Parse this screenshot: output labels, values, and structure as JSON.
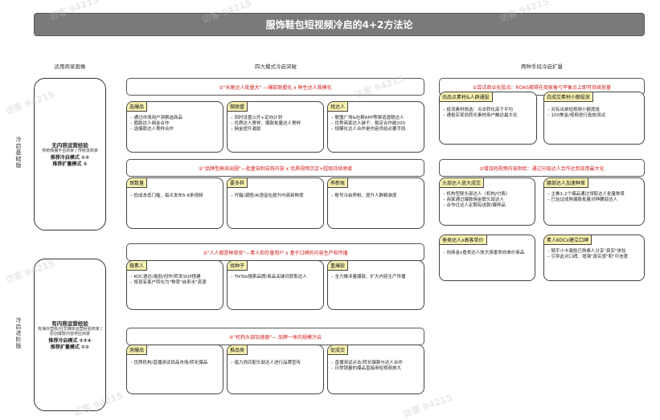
{
  "title": "服饰鞋包短视频冷启的4+2方法论",
  "col_heads": {
    "left": "适用商家画像",
    "mid": "四大模式冷启突破",
    "right": "两种手段冷启扩量"
  },
  "side_labels": {
    "top": "冷启基础版",
    "bottom": "冷启进阶版"
  },
  "left_boxes": [
    {
      "title": "无内容运营经验",
      "sub": "传统档播平台商家 / 传统货商家",
      "rec1": "推荐冷启模式 ①③",
      "rec2": "推荐扩量模式 ②"
    },
    {
      "title": "有内容运营经验",
      "sub": "有海外营收/社交媒体运营经验商家 / 原创爆款内容供应商家",
      "rec1": "推荐冷启模式 ②③④",
      "rec2": "推荐扩量模式 ①②"
    }
  ],
  "mid_banners": [
    "①\"长尾达人批量大\" —爆款联盟化 x 种生达人规模化",
    "②\"品牌型高效出圈\"—批量自制自购内容 x 优质视频沉淀+超级持续承接",
    "③\"人人都是种草官\"—素人和存量用户 x 基于口碑的内容生产和传播",
    "④\"机构头部加速器\"— 品牌一体的规模冷启"
  ],
  "mid_cards": [
    [
      {
        "title": "选爆品",
        "lines": [
          "– 通过市场用户洞察选商品",
          "– 圈款达人佣金合作",
          "– 选爆款达人寄样合作"
        ]
      },
      {
        "title": "做联盟",
        "lines": [
          "– 同时设置公开+定向计划",
          "– 优质达人寄样、爆款批量达人寄样",
          "– 佣金提升激励"
        ]
      },
      {
        "title": "找达人",
        "lines": [
          "– 联盟广场&社群APP等渠道邀联达人",
          "– 优秀商家达人破千、稳定合作破200",
          "– 规模化达人合作是内容供给必要手段"
        ]
      }
    ],
    [
      {
        "title": "保数量",
        "lines": [
          "– 低成本低门槛、每天发布5-6条视频"
        ]
      },
      {
        "title": "要多样",
        "lines": [
          "– 开箱/潮搭/AI语音包提升内容新鲜度"
        ]
      },
      {
        "title": "养新账",
        "lines": [
          "– 账号冷启养粉、提升人群精准度"
        ]
      }
    ],
    [
      {
        "title": "做素人",
        "lines": [
          "– KOC邀达/激励/创作/转发SOP搭建",
          "– 将现有客户转化为\"种草\"自来水\"资源"
        ]
      },
      {
        "title": "找种子",
        "lines": [
          "– TikTok搜索品牌/商品关键词获取达人"
        ]
      },
      {
        "title": "重爆款",
        "lines": [
          "– 全力推涉量爆款、扩大内容生产传播"
        ]
      }
    ],
    [
      {
        "title": "测爆品",
        "lines": [
          "– 优质机构/直播测试尚品市场/转化爆品"
        ]
      },
      {
        "title": "推品类",
        "lines": [
          "– 借力尚匹配头部达人进行品牌宣传"
        ]
      },
      {
        "title": "促成交",
        "lines": [
          "– 直播测试点击/转化爆款与达人合作",
          "– 日常销量的爆品直接用短视频放大"
        ]
      }
    ]
  ],
  "right_banners": [
    "①尝试商业化投流：ROAS梯得在商家备亏平衡点上即可持续放量",
    "②增加短视频内容供给：通过分层达人合作达到效用最大化"
  ],
  "right_cards": [
    [
      {
        "title": "尚品点素材&人群通投",
        "lines": [
          "– 投流素材挑选：点击转化高于平均",
          "– 通投实现尚转化素材用户触达最大化"
        ]
      },
      {
        "title": "白成交素材小额投放",
        "lines": [
          "– 对有出单短视频小额度投",
          "– 100美金/视频进行投放测试"
        ]
      }
    ],
    [
      {
        "title": "头部达人放大成交",
        "lines": [
          "– 机构型联头部达人（机构/付费）",
          "– 商家通过爆款佣金联头部达人",
          "– 合作过达人定期有送款/爆样品"
        ]
      },
      {
        "title": "腰部达人加速种草",
        "lines": [
          "– 主推1-2个爆品通过领取达人批量种草",
          "– 已验证成熟爆款批量对种腰部达人"
        ]
      }
    ],
    [
      {
        "title": "垂类达人x高客单价",
        "lines": [
          "– 向商金x垂类达人放大强垂类向单价商品"
        ]
      },
      {
        "title": "素人KOCx建立口碑",
        "lines": [
          "– 随手小卡激励已购素人分享\"真实\"体验",
          "– 引导此对口碑、增强\"真实感\"和\"可信度"
        ]
      }
    ]
  ],
  "watermark": "访客 94215"
}
